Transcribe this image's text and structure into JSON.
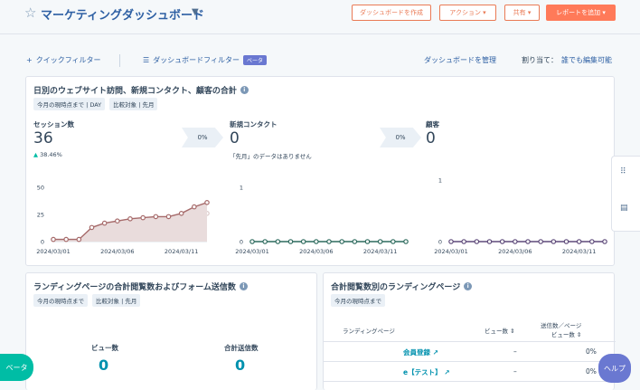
{
  "header": {
    "title": "マーケティングダッシュボード",
    "create_dashboard": "ダッシュボードを作成",
    "actions": "アクション",
    "share": "共有",
    "add_report": "レポートを追加"
  },
  "filters": {
    "quick_filter": "クイックフィルター",
    "dashboard_filter": "ダッシュボードフィルター",
    "beta_tag": "ベータ",
    "manage": "ダッシュボードを管理",
    "assign_label": "割り当て：",
    "assign_value": "誰でも編集可能"
  },
  "card1": {
    "title": "日別のウェブサイト訪問、新規コンタクト、顧客の合計",
    "tag1": "今月の現時点まで | DAY",
    "tag2": "比較対象 | 先月",
    "sessions": {
      "label": "セッション数",
      "value": "36",
      "delta": "38.46%",
      "compare": "0%"
    },
    "contacts": {
      "label": "新規コンタクト",
      "value": "0",
      "note": "「先月」のデータはありません",
      "compare": "0%"
    },
    "customers": {
      "label": "顧客",
      "value": "0"
    }
  },
  "chart_data": [
    {
      "type": "area",
      "title": "セッション数",
      "x": [
        "2024/03/01",
        "2024/03/02",
        "2024/03/03",
        "2024/03/04",
        "2024/03/05",
        "2024/03/06",
        "2024/03/07",
        "2024/03/08",
        "2024/03/09",
        "2024/03/10",
        "2024/03/11",
        "2024/03/12",
        "2024/03/13"
      ],
      "xticks": [
        "2024/03/01",
        "2024/03/06",
        "2024/03/11"
      ],
      "yticks": [
        "0",
        "25",
        "50"
      ],
      "ylim": [
        0,
        50
      ],
      "series": [
        {
          "values": [
            2,
            2,
            2,
            13,
            17,
            19,
            21,
            22,
            23,
            23,
            26,
            32,
            36
          ],
          "color": "#a66a6a"
        },
        {
          "values": [
            2,
            2,
            2,
            5,
            8,
            11,
            13,
            15,
            17,
            19,
            21,
            24,
            26
          ],
          "color": "#dccaca"
        }
      ]
    },
    {
      "type": "line",
      "title": "新規コンタクト",
      "x": [
        "2024/03/01",
        "2024/03/02",
        "2024/03/03",
        "2024/03/04",
        "2024/03/05",
        "2024/03/06",
        "2024/03/07",
        "2024/03/08",
        "2024/03/09",
        "2024/03/10",
        "2024/03/11",
        "2024/03/12",
        "2024/03/13"
      ],
      "xticks": [
        "2024/03/01",
        "2024/03/06",
        "2024/03/11"
      ],
      "yticks": [
        "0",
        "1"
      ],
      "ylim": [
        0,
        1
      ],
      "series": [
        {
          "values": [
            0,
            0,
            0,
            0,
            0,
            0,
            0,
            0,
            0,
            0,
            0,
            0,
            0
          ],
          "color": "#2e6b5e"
        }
      ]
    },
    {
      "type": "line",
      "title": "顧客",
      "x": [
        "2024/03/01",
        "2024/03/02",
        "2024/03/03",
        "2024/03/04",
        "2024/03/05",
        "2024/03/06",
        "2024/03/07",
        "2024/03/08",
        "2024/03/09",
        "2024/03/10",
        "2024/03/11",
        "2024/03/12",
        "2024/03/13"
      ],
      "xticks": [
        "2024/03/01",
        "2024/03/06",
        "2024/03/11"
      ],
      "yticks": [
        "0",
        "1"
      ],
      "ylim": [
        0,
        1
      ],
      "series": [
        {
          "values": [
            0,
            0,
            0,
            0,
            0,
            0,
            0,
            0,
            0,
            0,
            0,
            0,
            0
          ],
          "color": "#5e4a7a"
        }
      ]
    }
  ],
  "card2": {
    "title": "ランディングページの合計閲覧数およびフォーム送信数",
    "tag1": "今月の現時点まで",
    "tag2": "比較対象 | 先月",
    "views_label": "ビュー数",
    "views_value": "0",
    "submits_label": "合計送信数",
    "submits_value": "0"
  },
  "card3": {
    "title": "合計閲覧数別のランディングページ",
    "tag1": "今月の現時点まで",
    "col_page": "ランディングページ",
    "col_views": "ビュー数",
    "col_rate_line1": "送信数／ページ",
    "col_rate_line2": "ビュー数",
    "rows": [
      {
        "page": "会員登録",
        "views": "–",
        "rate": "0%"
      },
      {
        "page": "e【テスト】",
        "views": "–",
        "rate": "0%"
      }
    ]
  },
  "floating": {
    "beta": "ベータ",
    "help": "ヘルプ"
  }
}
